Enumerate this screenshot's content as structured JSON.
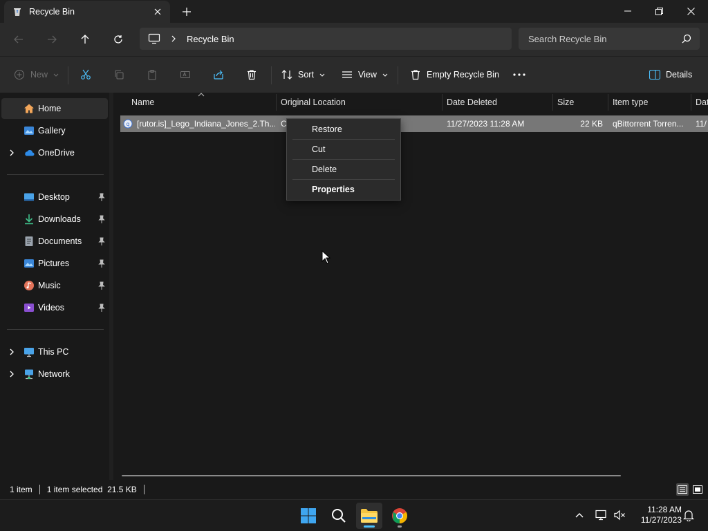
{
  "window": {
    "tab_title": "Recycle Bin",
    "tab_icon": "recycle-bin-icon"
  },
  "address": {
    "crumb": "Recycle Bin",
    "search_placeholder": "Search Recycle Bin"
  },
  "commands": {
    "new_label": "New",
    "sort_label": "Sort",
    "view_label": "View",
    "empty_label": "Empty Recycle Bin",
    "details_label": "Details"
  },
  "sidebar": {
    "items": [
      {
        "label": "Home",
        "icon": "home-icon"
      },
      {
        "label": "Gallery",
        "icon": "gallery-icon"
      },
      {
        "label": "OneDrive",
        "icon": "onedrive-icon"
      },
      {
        "label": "Desktop",
        "icon": "desktop-icon"
      },
      {
        "label": "Downloads",
        "icon": "downloads-icon"
      },
      {
        "label": "Documents",
        "icon": "documents-icon"
      },
      {
        "label": "Pictures",
        "icon": "pictures-icon"
      },
      {
        "label": "Music",
        "icon": "music-icon"
      },
      {
        "label": "Videos",
        "icon": "videos-icon"
      },
      {
        "label": "This PC",
        "icon": "this-pc-icon"
      },
      {
        "label": "Network",
        "icon": "network-icon"
      }
    ]
  },
  "columns": [
    "Name",
    "Original Location",
    "Date Deleted",
    "Size",
    "Item type",
    "Dat"
  ],
  "rows": [
    {
      "name": "[rutor.is]_Lego_Indiana_Jones_2.Th...",
      "location": "C",
      "date_deleted": "11/27/2023 11:28 AM",
      "size": "22 KB",
      "item_type": "qBittorrent Torren...",
      "extra": "11/"
    }
  ],
  "context_menu": [
    "Restore",
    "Cut",
    "Delete",
    "Properties"
  ],
  "status": {
    "count": "1 item",
    "selected": "1 item selected  21.5 KB"
  },
  "clock": {
    "time": "11:28 AM",
    "date": "11/27/2023"
  },
  "colors": {
    "background": "#191919",
    "chrome": "#2b2b2b",
    "selected_row": "#777777",
    "accent": "#4cc2ff"
  }
}
